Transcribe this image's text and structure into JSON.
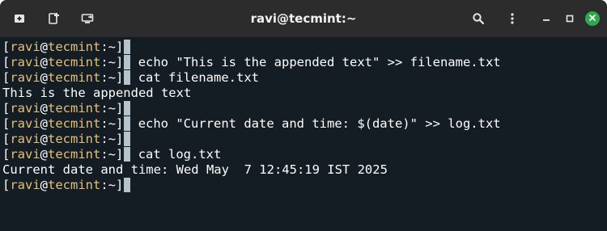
{
  "window": {
    "title": "ravi@tecmint:~"
  },
  "titlebar": {
    "new_tab_icon": "new-tab-icon",
    "split_icon": "split-terminal-icon",
    "broadcast_icon": "broadcast-icon",
    "search_icon": "search-icon",
    "menu_icon": "menu-icon",
    "minimize_icon": "minimize-icon",
    "maximize_icon": "maximize-icon",
    "close_icon": "close-icon"
  },
  "prompt": {
    "open": "[",
    "user": "ravi",
    "at": "@",
    "host": "tecmint",
    "path": ":~",
    "close": "]"
  },
  "lines": [
    {
      "type": "prompt",
      "command": ""
    },
    {
      "type": "prompt",
      "command": " echo \"This is the appended text\" >> filename.txt"
    },
    {
      "type": "prompt",
      "command": " cat filename.txt"
    },
    {
      "type": "output",
      "text": "This is the appended text"
    },
    {
      "type": "prompt",
      "command": ""
    },
    {
      "type": "prompt",
      "command": " echo \"Current date and time: $(date)\" >> log.txt"
    },
    {
      "type": "prompt",
      "command": ""
    },
    {
      "type": "prompt",
      "command": " cat log.txt"
    },
    {
      "type": "output",
      "text": "Current date and time: Wed May  7 12:45:19 IST 2025"
    },
    {
      "type": "prompt",
      "command": ""
    }
  ],
  "colors": {
    "background": "#141c24",
    "titlebar": "#2c2c2c",
    "prompt_user": "#e5c07b",
    "close_button": "#2fa84f"
  }
}
